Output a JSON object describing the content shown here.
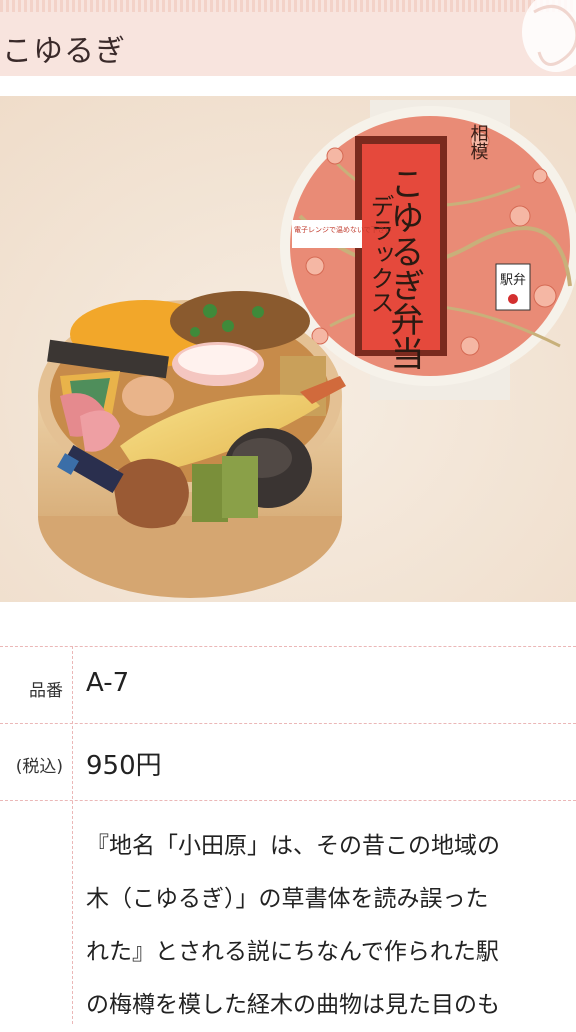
{
  "header": {
    "title": "こゆるぎ"
  },
  "photo": {
    "alt": "",
    "package_labels": {
      "origin": "相模",
      "brand": "デラックス",
      "name": "こゆるぎ弁当",
      "stamp": "駅弁",
      "notice": "電子レンジで温めないで下さい"
    },
    "colors": {
      "lid": "#e98b76",
      "box": "#e7c39a",
      "background": "#f3e6d8"
    }
  },
  "table": {
    "rows": [
      {
        "label": "品番",
        "value": "A-7"
      },
      {
        "label": "(税込)",
        "value": "950円"
      }
    ],
    "description_lines": [
      "『地名「小田原」は、その昔この地域の",
      "木（こゆるぎ）」の草書体を読み誤った",
      "れた』とされる説にちなんで作られた駅",
      "の梅樽を模した経木の曲物は見た目のも"
    ]
  }
}
